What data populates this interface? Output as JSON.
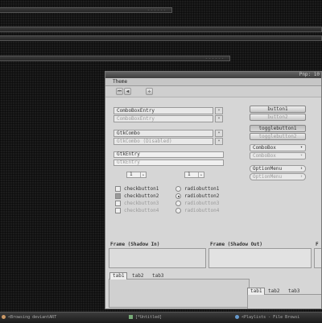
{
  "background_windows": [
    {
      "title": "------"
    },
    {
      "title": ""
    },
    {
      "title": ""
    },
    {
      "title": "------"
    }
  ],
  "window": {
    "title": "Pnp: 10"
  },
  "menu": {
    "theme": "Theme"
  },
  "toolbar": {
    "icons": [
      "first-icon",
      "prev-icon",
      "grid-icon"
    ]
  },
  "combos": {
    "entry1": "ComboBoxEntry",
    "entry2": "ComboBoxEntry",
    "combo1": "GtkCombo",
    "combo2": "GtkCombo (Disabled)"
  },
  "entries": {
    "entry1": "GtkEntry",
    "entry2": "GtkEntry"
  },
  "spins": {
    "spin1": "1",
    "spin2": "1"
  },
  "checks": [
    {
      "label": "checkbutton1",
      "checked": false
    },
    {
      "label": "checkbutton2",
      "checked": true
    },
    {
      "label": "checkbutton3",
      "checked": false
    },
    {
      "label": "checkbutton4",
      "checked": false
    }
  ],
  "radios": [
    {
      "label": "radiobutton1",
      "checked": false
    },
    {
      "label": "radiobutton2",
      "checked": true
    },
    {
      "label": "radiobutton3",
      "checked": false
    },
    {
      "label": "radiobutton4",
      "checked": false
    }
  ],
  "buttons": {
    "button1": "button1",
    "button2": "button2",
    "toggle1": "togglebutton1",
    "toggle2": "togglebutton2"
  },
  "right_combos": {
    "combobox1": "ComboBox",
    "combobox2": "ComboBox",
    "option1": "OptionMenu",
    "option2": "OptionMenu"
  },
  "frames": {
    "in": "Frame (Shadow In)",
    "out": "Frame (Shadow Out)",
    "third": "F"
  },
  "tabs_left": [
    "tab1",
    "tab2",
    "tab3"
  ],
  "tabs_right": [
    "tab1",
    "tab2",
    "tab3"
  ],
  "taskbar": [
    {
      "label": "<Browsing deviantART"
    },
    {
      "label": "[*Untitled]"
    },
    {
      "label": "<Playlists - File Browsi"
    }
  ]
}
